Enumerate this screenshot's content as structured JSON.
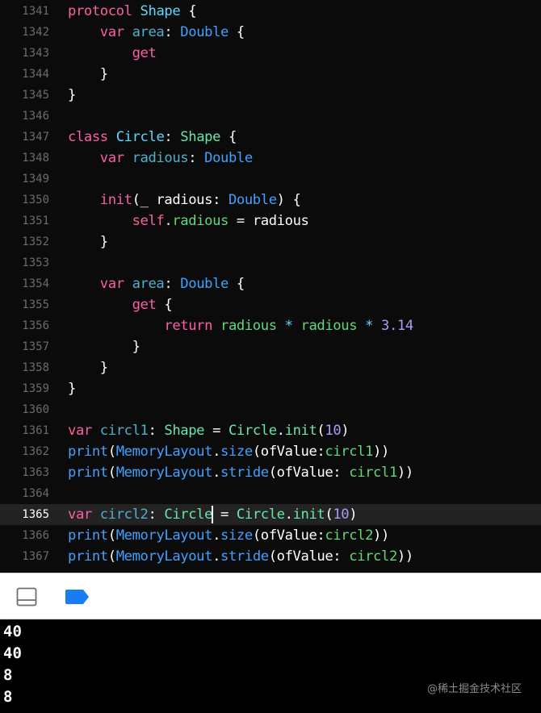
{
  "editor": {
    "current_line": 1365,
    "lines": [
      {
        "n": "1341",
        "tokens": [
          [
            "keyword",
            "protocol"
          ],
          [
            "plain",
            " "
          ],
          [
            "type",
            "Shape"
          ],
          [
            "plain",
            " {"
          ]
        ]
      },
      {
        "n": "1342",
        "tokens": [
          [
            "plain",
            "    "
          ],
          [
            "keyword",
            "var"
          ],
          [
            "plain",
            " "
          ],
          [
            "userVar",
            "area"
          ],
          [
            "plain",
            ": "
          ],
          [
            "typeStd",
            "Double"
          ],
          [
            "plain",
            " {"
          ]
        ]
      },
      {
        "n": "1343",
        "tokens": [
          [
            "plain",
            "        "
          ],
          [
            "keyword",
            "get"
          ]
        ]
      },
      {
        "n": "1344",
        "tokens": [
          [
            "plain",
            "    }"
          ]
        ]
      },
      {
        "n": "1345",
        "tokens": [
          [
            "plain",
            "}"
          ]
        ]
      },
      {
        "n": "1346",
        "tokens": []
      },
      {
        "n": "1347",
        "tokens": [
          [
            "keyword",
            "class"
          ],
          [
            "plain",
            " "
          ],
          [
            "type",
            "Circle"
          ],
          [
            "plain",
            ": "
          ],
          [
            "userType",
            "Shape"
          ],
          [
            "plain",
            " {"
          ]
        ]
      },
      {
        "n": "1348",
        "tokens": [
          [
            "plain",
            "    "
          ],
          [
            "keyword",
            "var"
          ],
          [
            "plain",
            " "
          ],
          [
            "userVar",
            "radious"
          ],
          [
            "plain",
            ": "
          ],
          [
            "typeStd",
            "Double"
          ]
        ]
      },
      {
        "n": "1349",
        "tokens": []
      },
      {
        "n": "1350",
        "tokens": [
          [
            "plain",
            "    "
          ],
          [
            "keyword",
            "init"
          ],
          [
            "plain",
            "(_ radious: "
          ],
          [
            "typeStd",
            "Double"
          ],
          [
            "plain",
            ") {"
          ]
        ]
      },
      {
        "n": "1351",
        "tokens": [
          [
            "plain",
            "        "
          ],
          [
            "keyword",
            "self"
          ],
          [
            "plain",
            "."
          ],
          [
            "green",
            "radious"
          ],
          [
            "plain",
            " = radious"
          ]
        ]
      },
      {
        "n": "1352",
        "tokens": [
          [
            "plain",
            "    }"
          ]
        ]
      },
      {
        "n": "1353",
        "tokens": []
      },
      {
        "n": "1354",
        "tokens": [
          [
            "plain",
            "    "
          ],
          [
            "keyword",
            "var"
          ],
          [
            "plain",
            " "
          ],
          [
            "userVar",
            "area"
          ],
          [
            "plain",
            ": "
          ],
          [
            "typeStd",
            "Double"
          ],
          [
            "plain",
            " {"
          ]
        ]
      },
      {
        "n": "1355",
        "tokens": [
          [
            "plain",
            "        "
          ],
          [
            "keyword",
            "get"
          ],
          [
            "plain",
            " {"
          ]
        ]
      },
      {
        "n": "1356",
        "tokens": [
          [
            "plain",
            "            "
          ],
          [
            "keyword",
            "return"
          ],
          [
            "plain",
            " "
          ],
          [
            "green",
            "radious"
          ],
          [
            "plain",
            " "
          ],
          [
            "type",
            "*"
          ],
          [
            "plain",
            " "
          ],
          [
            "green",
            "radious"
          ],
          [
            "plain",
            " "
          ],
          [
            "type",
            "*"
          ],
          [
            "plain",
            " "
          ],
          [
            "number",
            "3.14"
          ]
        ]
      },
      {
        "n": "1357",
        "tokens": [
          [
            "plain",
            "        }"
          ]
        ]
      },
      {
        "n": "1358",
        "tokens": [
          [
            "plain",
            "    }"
          ]
        ]
      },
      {
        "n": "1359",
        "tokens": [
          [
            "plain",
            "}"
          ]
        ]
      },
      {
        "n": "1360",
        "tokens": []
      },
      {
        "n": "1361",
        "tokens": [
          [
            "keyword",
            "var"
          ],
          [
            "plain",
            " "
          ],
          [
            "userVar",
            "circl1"
          ],
          [
            "plain",
            ": "
          ],
          [
            "userType",
            "Shape"
          ],
          [
            "plain",
            " = "
          ],
          [
            "userType",
            "Circle"
          ],
          [
            "plain",
            "."
          ],
          [
            "userType",
            "init"
          ],
          [
            "plain",
            "("
          ],
          [
            "number",
            "10"
          ],
          [
            "plain",
            ")"
          ]
        ]
      },
      {
        "n": "1362",
        "tokens": [
          [
            "prop",
            "print"
          ],
          [
            "plain",
            "("
          ],
          [
            "prop",
            "MemoryLayout"
          ],
          [
            "plain",
            "."
          ],
          [
            "prop",
            "size"
          ],
          [
            "plain",
            "(ofValue:"
          ],
          [
            "green",
            "circl1"
          ],
          [
            "plain",
            "))"
          ]
        ]
      },
      {
        "n": "1363",
        "tokens": [
          [
            "prop",
            "print"
          ],
          [
            "plain",
            "("
          ],
          [
            "prop",
            "MemoryLayout"
          ],
          [
            "plain",
            "."
          ],
          [
            "prop",
            "stride"
          ],
          [
            "plain",
            "(ofValue: "
          ],
          [
            "green",
            "circl1"
          ],
          [
            "plain",
            "))"
          ]
        ]
      },
      {
        "n": "1364",
        "tokens": []
      },
      {
        "n": "1365",
        "tokens": [
          [
            "keyword",
            "var"
          ],
          [
            "plain",
            " "
          ],
          [
            "userVar",
            "circl2"
          ],
          [
            "plain",
            ": "
          ],
          [
            "userType",
            "Circle"
          ],
          [
            "cursor",
            ""
          ],
          [
            "plain",
            " = "
          ],
          [
            "userType",
            "Circle"
          ],
          [
            "plain",
            "."
          ],
          [
            "userType",
            "init"
          ],
          [
            "plain",
            "("
          ],
          [
            "number",
            "10"
          ],
          [
            "plain",
            ")"
          ]
        ]
      },
      {
        "n": "1366",
        "tokens": [
          [
            "prop",
            "print"
          ],
          [
            "plain",
            "("
          ],
          [
            "prop",
            "MemoryLayout"
          ],
          [
            "plain",
            "."
          ],
          [
            "prop",
            "size"
          ],
          [
            "plain",
            "(ofValue:"
          ],
          [
            "green",
            "circl2"
          ],
          [
            "plain",
            "))"
          ]
        ]
      },
      {
        "n": "1367",
        "tokens": [
          [
            "prop",
            "print"
          ],
          [
            "plain",
            "("
          ],
          [
            "prop",
            "MemoryLayout"
          ],
          [
            "plain",
            "."
          ],
          [
            "prop",
            "stride"
          ],
          [
            "plain",
            "(ofValue: "
          ],
          [
            "green",
            "circl2"
          ],
          [
            "plain",
            "))"
          ]
        ]
      }
    ]
  },
  "toolbar": {
    "hide_debug_icon": "panel-toggle-icon",
    "breakpoint_icon": "breakpoint-icon",
    "accent_color": "#1a7cf5"
  },
  "console": {
    "output": [
      "40",
      "40",
      "8",
      "8"
    ]
  },
  "watermark": "@稀土掘金技术社区"
}
